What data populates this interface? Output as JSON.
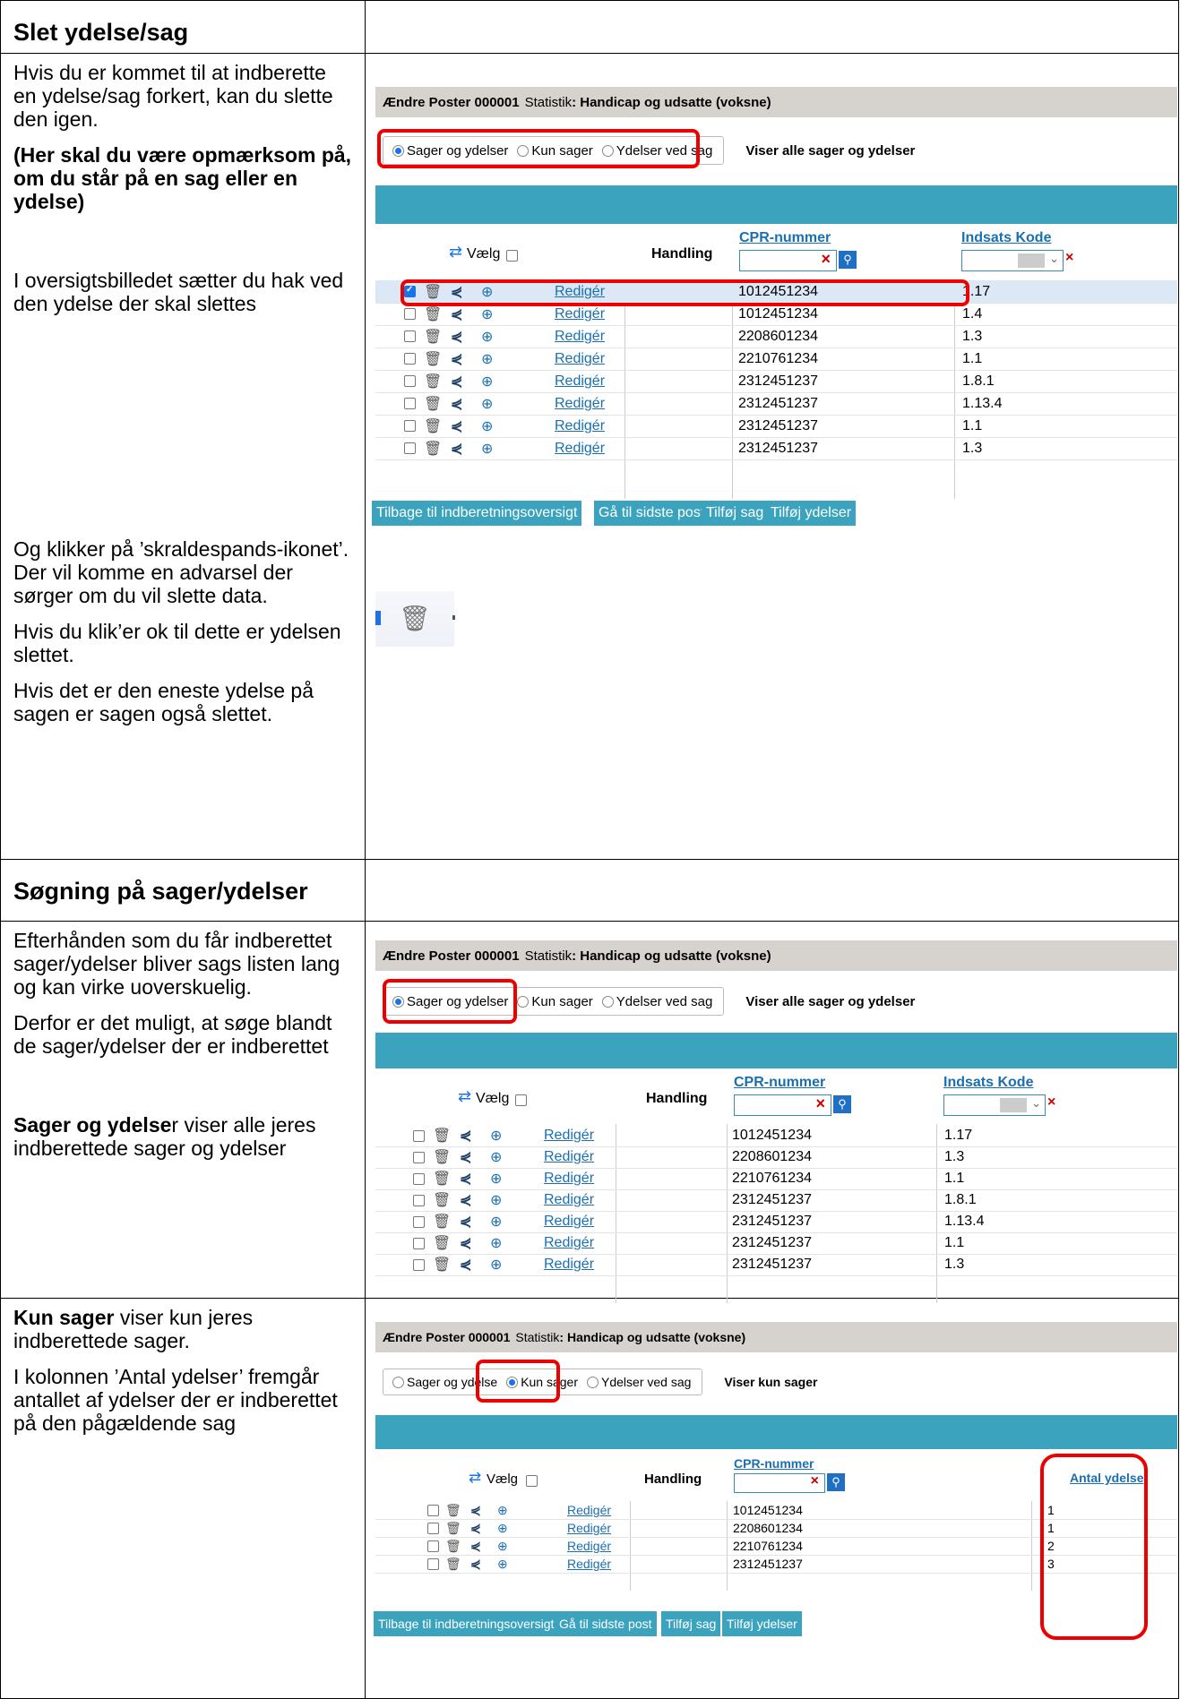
{
  "section1": {
    "header": "Slet ydelse/sag",
    "p1": "Hvis du er kommet til at indberette en ydelse/sag forkert, kan du slette den igen.",
    "p2": "(Her skal du være opmærksom på, om du står på en sag eller en ydelse)",
    "p3": "I oversigtsbilledet sætter du hak ved den ydelse der skal slettes",
    "p4": "Og klikker på ’skraldespands-ikonet’. Der vil komme en advarsel der sørger om du vil slette data.",
    "p5": "Hvis du klik’er ok til dette er ydelsen slettet.",
    "p6": "Hvis det er den eneste ydelse på sagen er sagen også slettet."
  },
  "section2": {
    "header": "Søgning på sager/ydelser",
    "p1": "Efterhånden som du får indberettet sager/ydelser bliver sags listen lang og kan virke uoverskuelig.",
    "p2": "Derfor er det muligt, at søge blandt de sager/ydelser der er indberettet",
    "p3_bold": "Sager og ydelse",
    "p3_rest": "r viser alle jeres indberettede sager og ydelser"
  },
  "section3": {
    "p1_bold": "Kun sager",
    "p1_rest": " viser kun jeres indberettede sager.",
    "p2": "I kolonnen ’Antal ydelser’ fremgår antallet af ydelser der er indberettet på den pågældende sag"
  },
  "ui": {
    "title_bold": "Ændre Poster 000001",
    "title_stat": "Statistik",
    "title_value": ": Handicap og udsatte (voksne)",
    "radio1": "Sager og ydelser",
    "radio1_cut": "Sager og ydelse",
    "radio2": "Kun sager",
    "radio3": "Ydelser ved sag",
    "viser_all": "Viser alle sager og ydelser",
    "viser_kun": "Viser kun sager",
    "vaelg": "Vælg",
    "handling": "Handling",
    "cpr": "CPR-nummer",
    "indsats": "Indsats Kode",
    "antal": "Antal ydelse",
    "rediger": "Redigér",
    "btn_tilbage": "Tilbage til indberetningsoversigt",
    "btn_gaa": "Gå til sidste post",
    "btn_sag": "Tilføj sag",
    "btn_ydelser": "Tilføj ydelser"
  },
  "table1": [
    {
      "cpr": "1012451234",
      "kode": "1.17",
      "checked": true
    },
    {
      "cpr": "1012451234",
      "kode": "1.4",
      "checked": false
    },
    {
      "cpr": "2208601234",
      "kode": "1.3",
      "checked": false
    },
    {
      "cpr": "2210761234",
      "kode": "1.1",
      "checked": false
    },
    {
      "cpr": "2312451237",
      "kode": "1.8.1",
      "checked": false
    },
    {
      "cpr": "2312451237",
      "kode": "1.13.4",
      "checked": false
    },
    {
      "cpr": "2312451237",
      "kode": "1.1",
      "checked": false
    },
    {
      "cpr": "2312451237",
      "kode": "1.3",
      "checked": false
    }
  ],
  "table2": [
    {
      "cpr": "1012451234",
      "kode": "1.17"
    },
    {
      "cpr": "2208601234",
      "kode": "1.3"
    },
    {
      "cpr": "2210761234",
      "kode": "1.1"
    },
    {
      "cpr": "2312451237",
      "kode": "1.8.1"
    },
    {
      "cpr": "2312451237",
      "kode": "1.13.4"
    },
    {
      "cpr": "2312451237",
      "kode": "1.1"
    },
    {
      "cpr": "2312451237",
      "kode": "1.3"
    }
  ],
  "table3": [
    {
      "cpr": "1012451234",
      "antal": "1"
    },
    {
      "cpr": "2208601234",
      "antal": "1"
    },
    {
      "cpr": "2210761234",
      "antal": "2"
    },
    {
      "cpr": "2312451237",
      "antal": "3"
    }
  ],
  "icons": {
    "trash": "trash-icon",
    "share": "share-icon",
    "plus": "plus-circle-icon",
    "refresh": "refresh-icon",
    "search": "search-icon",
    "clear": "clear-x-icon"
  }
}
